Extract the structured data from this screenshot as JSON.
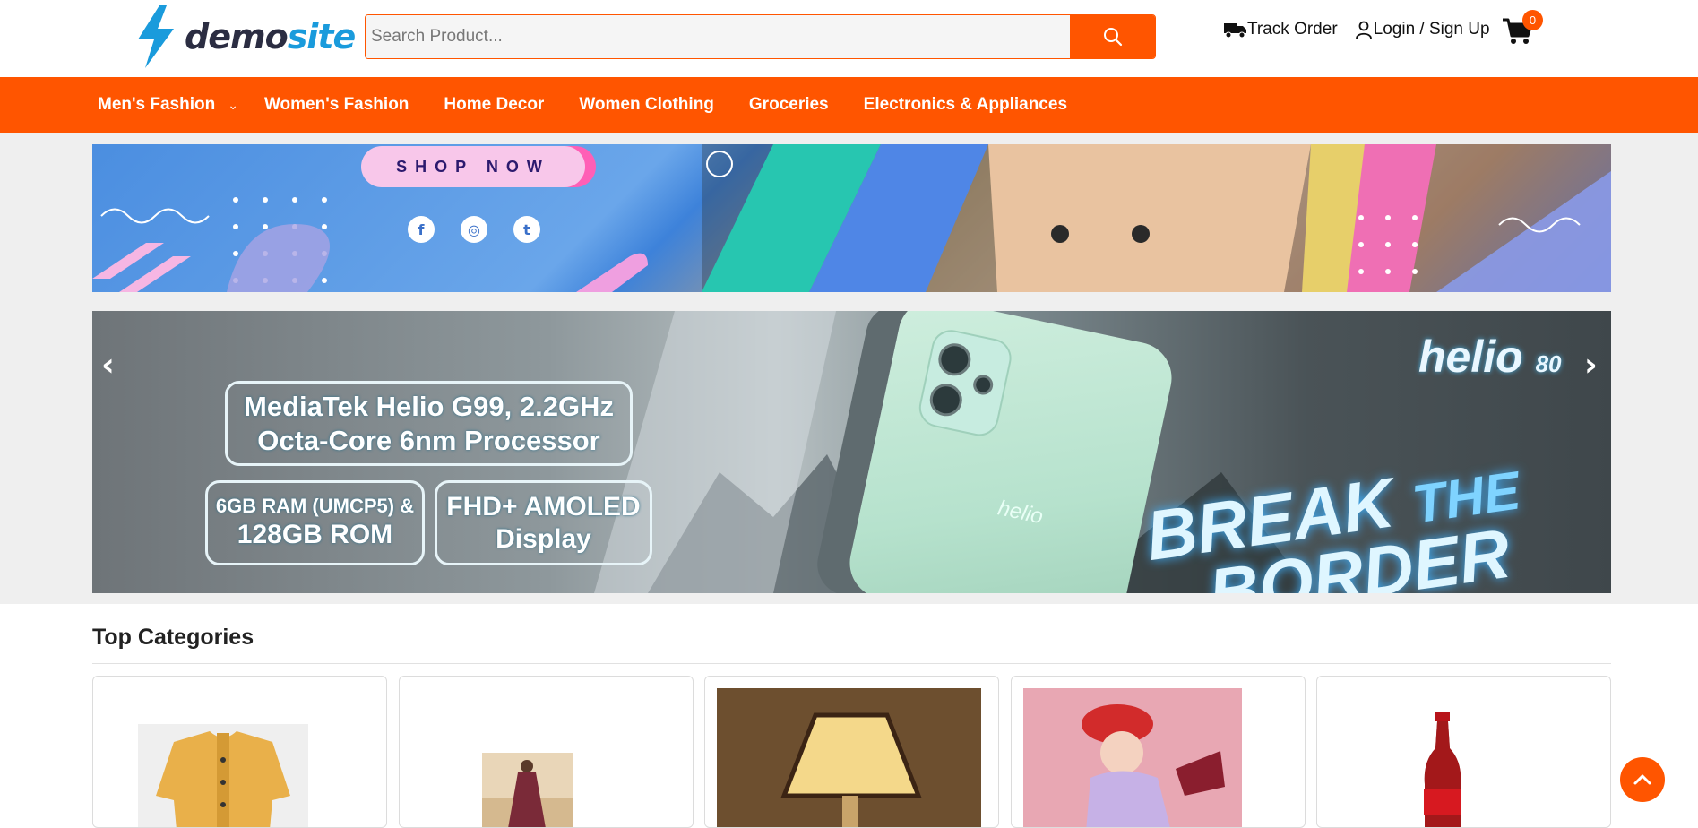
{
  "header": {
    "logo": {
      "part1": "demo",
      "part2": "site"
    },
    "search": {
      "placeholder": "Search Product..."
    },
    "links": {
      "track_order": "Track Order",
      "login": "Login / Sign Up"
    },
    "cart": {
      "count": "0"
    }
  },
  "nav": {
    "items": [
      {
        "label": "Men's Fashion",
        "has_dropdown": true
      },
      {
        "label": "Women's Fashion"
      },
      {
        "label": "Home Decor"
      },
      {
        "label": "Women Clothing"
      },
      {
        "label": "Groceries"
      },
      {
        "label": "Electronics & Appliances"
      }
    ]
  },
  "banner": {
    "shop_now": "SHOP NOW",
    "social": {
      "facebook": "f",
      "instagram": "◎",
      "twitter": "t"
    }
  },
  "slider": {
    "prev": "‹",
    "next": "›",
    "spec1": {
      "line1": "MediaTek Helio G99, 2.2GHz",
      "line2": "Octa-Core 6nm Processor"
    },
    "spec2": {
      "line1": "6GB RAM (UMCP5) &",
      "line2": "128GB ROM"
    },
    "spec3": {
      "line1": "FHD+ AMOLED",
      "line2": "Display"
    },
    "brand_title": "helio",
    "brand_model": "80",
    "phone_brand": "helio",
    "tagline1": "BREAK",
    "tagline2": "THE",
    "tagline3": "BORDER"
  },
  "categories": {
    "title": "Top Categories"
  },
  "colors": {
    "accent": "#ff5500",
    "logo_dark": "#2b2d42",
    "logo_blue": "#1a9bdc"
  }
}
